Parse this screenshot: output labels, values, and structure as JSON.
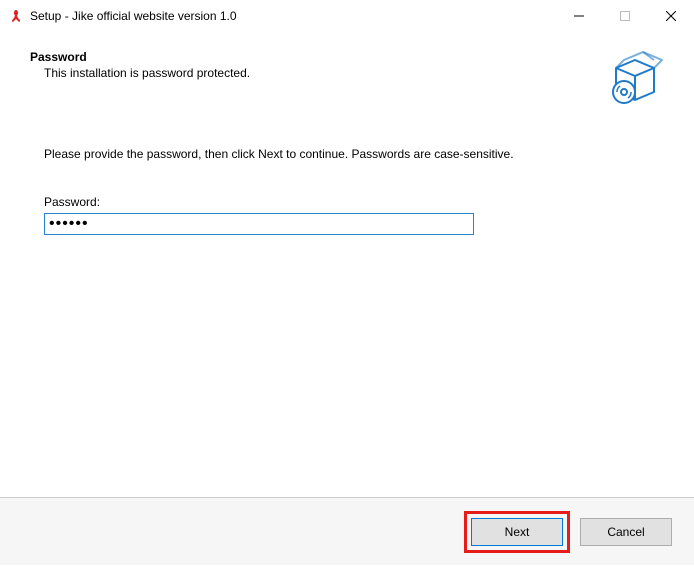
{
  "titlebar": {
    "title": "Setup - Jike official website version 1.0"
  },
  "header": {
    "heading": "Password",
    "subheading": "This installation is password protected."
  },
  "body": {
    "instruction": "Please provide the password, then click Next to continue. Passwords are case-sensitive.",
    "password_label": "Password:",
    "password_value": "••••••"
  },
  "footer": {
    "next_label": "Next",
    "cancel_label": "Cancel"
  }
}
